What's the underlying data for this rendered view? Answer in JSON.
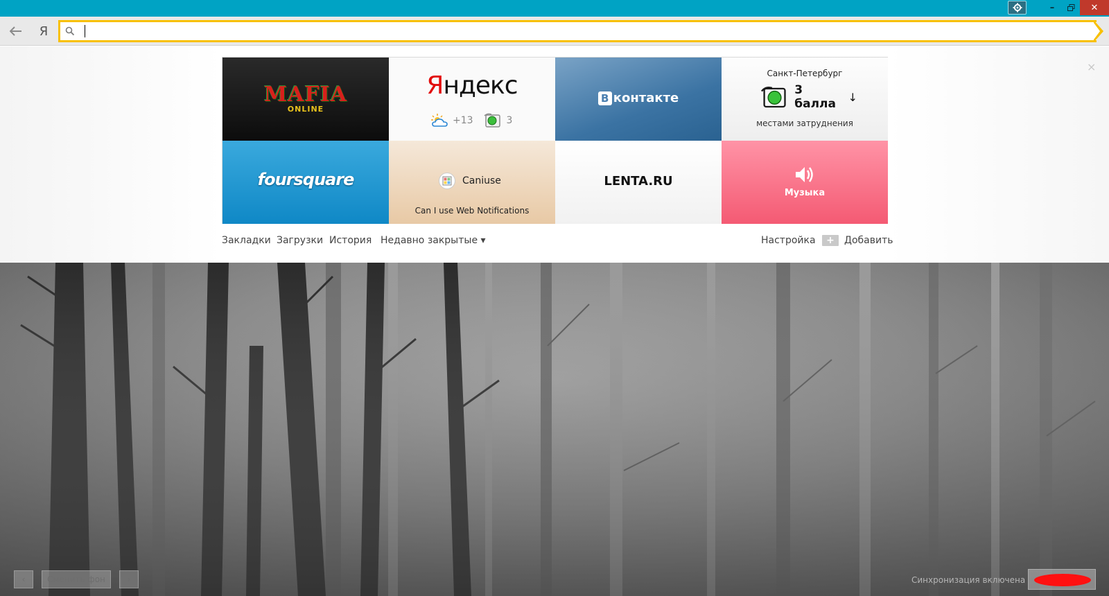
{
  "window": {
    "settings_icon": "gear-icon",
    "minimize_icon": "minimize-icon",
    "maximize_icon": "restore-icon",
    "close_icon": "close-icon",
    "accent": "#00a3c4",
    "close_color": "#c0392b"
  },
  "toolbar": {
    "back_icon": "arrow-left-icon",
    "yandex_button": "Я",
    "search_icon": "search-icon",
    "omnibox_value": "",
    "omnibox_border": "#f8c000"
  },
  "tableau": {
    "close_label": "×",
    "tiles": [
      {
        "id": "mafia",
        "logo": "MAFIA",
        "sub": "ONLINE"
      },
      {
        "id": "yandex",
        "logo_first": "Я",
        "logo_rest": "ндекс",
        "weather": "+13",
        "traffic": "3"
      },
      {
        "id": "vk",
        "logo_b": "В",
        "logo_text": "контакте"
      },
      {
        "id": "traffic",
        "city": "Санкт-Петербург",
        "score": "3 балла",
        "arrow": "↓",
        "note": "местами затруднения"
      },
      {
        "id": "foursquare",
        "logo": "foursquare"
      },
      {
        "id": "caniuse",
        "label": "Caniuse",
        "sub": "Can I use Web Notifications"
      },
      {
        "id": "lenta",
        "logo": "LENTA.RU"
      },
      {
        "id": "music",
        "label": "Музыка"
      }
    ]
  },
  "links": {
    "bookmarks": "Закладки",
    "downloads": "Загрузки",
    "history": "История",
    "recently_closed": "Недавно закрытые ▾",
    "settings": "Настройка",
    "add_plus": "+",
    "add": "Добавить"
  },
  "bottom": {
    "prev": "‹",
    "change_bg": "Сменить фон",
    "next": "›",
    "sync_status": "Синхронизация включена"
  }
}
